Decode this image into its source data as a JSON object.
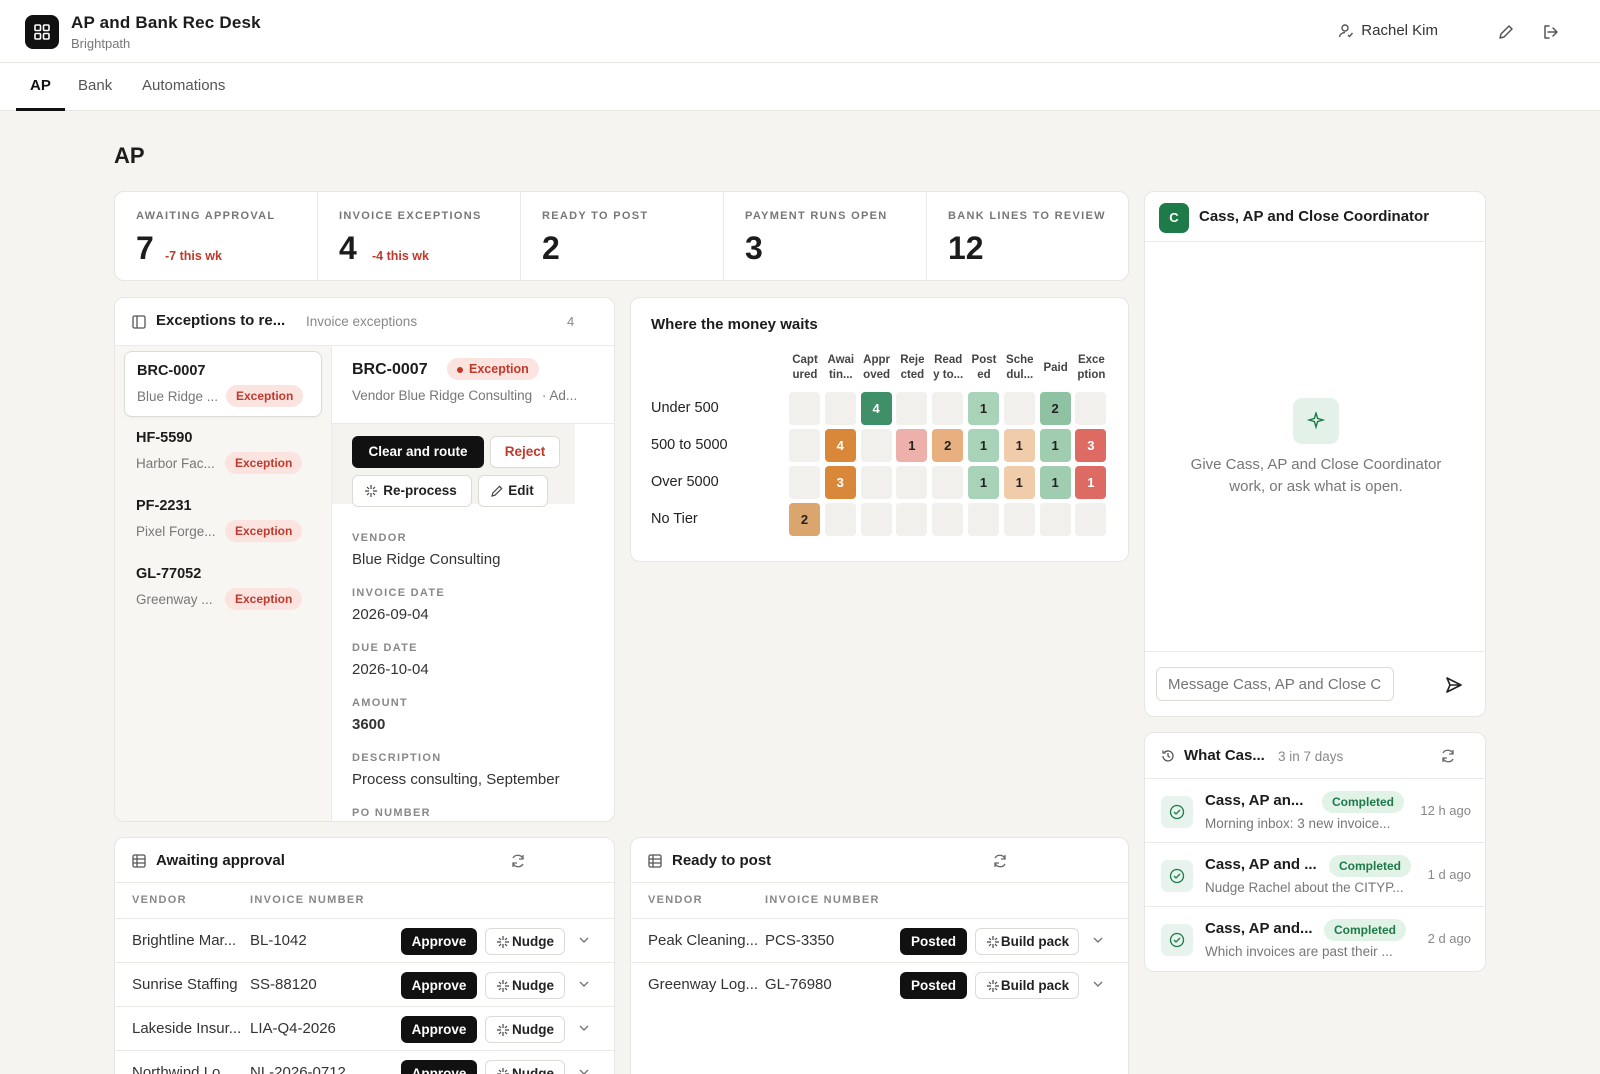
{
  "app": {
    "title": "AP and Bank Rec Desk",
    "org": "Brightpath",
    "user": "Rachel Kim"
  },
  "tabs": [
    "AP",
    "Bank",
    "Automations"
  ],
  "page_title": "AP",
  "kpis": [
    {
      "label": "AWAITING APPROVAL",
      "value": "7",
      "delta": "-7 this wk"
    },
    {
      "label": "INVOICE EXCEPTIONS",
      "value": "4",
      "delta": "-4 this wk"
    },
    {
      "label": "READY TO POST",
      "value": "2",
      "delta": ""
    },
    {
      "label": "PAYMENT RUNS OPEN",
      "value": "3",
      "delta": ""
    },
    {
      "label": "BANK LINES TO REVIEW",
      "value": "12",
      "delta": ""
    }
  ],
  "exceptions": {
    "title": "Exceptions to re...",
    "subtitle": "Invoice exceptions",
    "count": "4",
    "items": [
      {
        "id": "BRC-0007",
        "vendor": "Blue Ridge ...",
        "status": "Exception"
      },
      {
        "id": "HF-5590",
        "vendor": "Harbor Fac...",
        "status": "Exception"
      },
      {
        "id": "PF-2231",
        "vendor": "Pixel Forge...",
        "status": "Exception"
      },
      {
        "id": "GL-77052",
        "vendor": "Greenway ...",
        "status": "Exception"
      }
    ],
    "detail": {
      "id": "BRC-0007",
      "status": "Exception",
      "vendor_line": "Vendor Blue Ridge Consulting",
      "vendor_line_more": "·  Ad...",
      "actions": {
        "clear": "Clear and route",
        "reject": "Reject",
        "reprocess": "Re-process",
        "edit": "Edit"
      },
      "fields": [
        {
          "label": "VENDOR",
          "value": "Blue Ridge Consulting"
        },
        {
          "label": "INVOICE DATE",
          "value": "2026-09-04"
        },
        {
          "label": "DUE DATE",
          "value": "2026-10-04"
        },
        {
          "label": "AMOUNT",
          "value": "3600"
        },
        {
          "label": "DESCRIPTION",
          "value": "Process consulting, September"
        },
        {
          "label": "PO NUMBER",
          "value": ""
        }
      ]
    }
  },
  "heatmap": {
    "title": "Where the money waits",
    "columns": [
      [
        "Capt",
        "ured"
      ],
      [
        "Awai",
        "tin..."
      ],
      [
        "Appr",
        "oved"
      ],
      [
        "Reje",
        "cted"
      ],
      [
        "Read",
        "y to..."
      ],
      [
        "Post",
        "ed"
      ],
      [
        "Sche",
        "dul..."
      ],
      [
        "Paid",
        ""
      ],
      [
        "Exce",
        "ption"
      ]
    ],
    "rows": [
      {
        "label": "Under 500",
        "values": [
          0,
          0,
          4,
          0,
          0,
          1,
          0,
          2,
          0
        ]
      },
      {
        "label": "500 to 5000",
        "values": [
          0,
          4,
          0,
          1,
          2,
          1,
          1,
          1,
          3
        ]
      },
      {
        "label": "Over 5000",
        "values": [
          0,
          3,
          0,
          0,
          0,
          1,
          1,
          1,
          1
        ]
      },
      {
        "label": "No Tier",
        "values": [
          2,
          0,
          0,
          0,
          0,
          0,
          0,
          0,
          0
        ]
      }
    ],
    "column_colors": [
      "#dba56e",
      "#d9883a",
      "#3f8f69",
      "#eeb0ab",
      "#e7b07e",
      "#a9d3b8",
      "#f0ccaa",
      "#a0ccb0",
      "#dd6b63"
    ],
    "strong_colors": {
      "Awai": "#d58135",
      "Under500-Paid": "#8fc2a2"
    }
  },
  "assistant": {
    "name": "Cass, AP and Close Coordinator",
    "avatar": "C",
    "empty_text": "Give Cass, AP and Close Coordinator work, or ask what is open.",
    "placeholder": "Message Cass, AP and Close C..."
  },
  "activity": {
    "title": "What Cas...",
    "meta": "3 in 7 days",
    "items": [
      {
        "title": "Cass, AP an...",
        "status": "Completed",
        "sub": "Morning inbox: 3 new invoice...",
        "time": "12 h ago"
      },
      {
        "title": "Cass, AP and ...",
        "status": "Completed",
        "sub": "Nudge Rachel about the CITYP...",
        "time": "1 d ago"
      },
      {
        "title": "Cass, AP and...",
        "status": "Completed",
        "sub": "Which invoices are past their ...",
        "time": "2 d ago"
      }
    ]
  },
  "awaiting": {
    "title": "Awaiting approval",
    "headers": [
      "VENDOR",
      "INVOICE NUMBER"
    ],
    "approve": "Approve",
    "nudge": "Nudge",
    "rows": [
      {
        "vendor": "Brightline Mar...",
        "invoice": "BL-1042"
      },
      {
        "vendor": "Sunrise Staffing",
        "invoice": "SS-88120"
      },
      {
        "vendor": "Lakeside Insur...",
        "invoice": "LIA-Q4-2026"
      },
      {
        "vendor": "Northwind Lo...",
        "invoice": "NL-2026-0712"
      }
    ]
  },
  "ready": {
    "title": "Ready to post",
    "headers": [
      "VENDOR",
      "INVOICE NUMBER"
    ],
    "posted": "Posted",
    "build": "Build pack",
    "rows": [
      {
        "vendor": "Peak Cleaning...",
        "invoice": "PCS-3350"
      },
      {
        "vendor": "Greenway Log...",
        "invoice": "GL-76980"
      }
    ]
  }
}
